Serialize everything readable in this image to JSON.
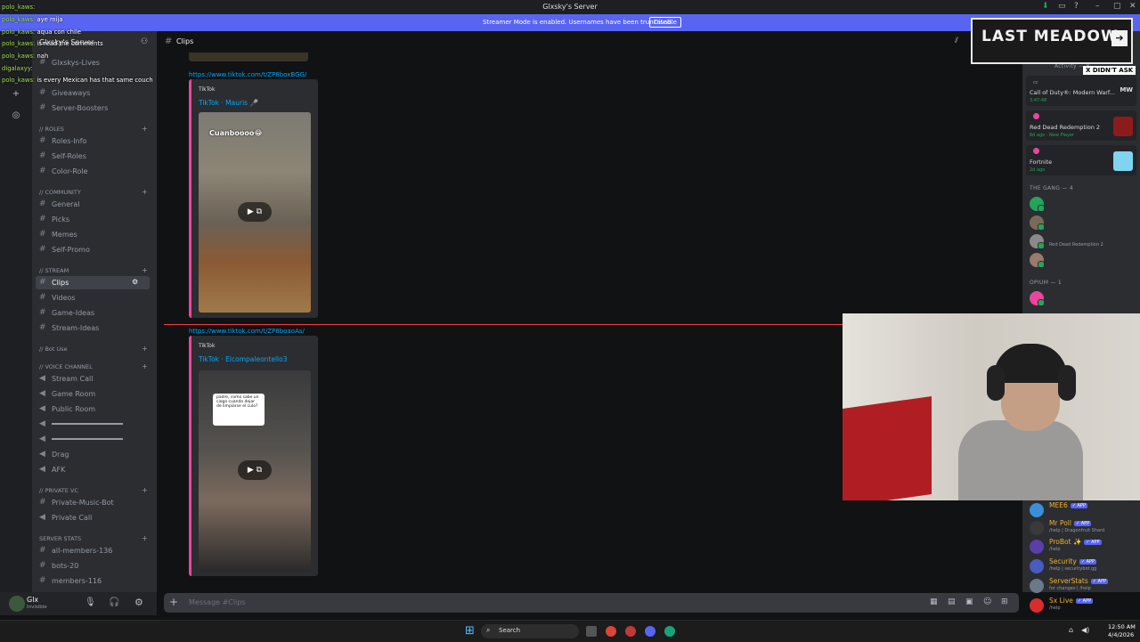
{
  "window": {
    "title": "Glxsky's Server"
  },
  "banner": {
    "message": "Streamer Mode is enabled. Usernames have been truncated.",
    "button": "Disable"
  },
  "server": {
    "name": "Glxsky's Server"
  },
  "channels": {
    "top": [
      "Glxskys-Lives",
      "Giveaways",
      "Server-Boosters"
    ],
    "roles_cat": "// ROLES",
    "roles": [
      "Roles-Info",
      "Self-Roles",
      "Color-Role"
    ],
    "community_cat": "// COMMUNITY",
    "community": [
      "General",
      "Picks",
      "Memes",
      "Self-Promo"
    ],
    "stream_cat": "// STREAM",
    "stream": [
      "Clips",
      "Videos",
      "Game-Ideas",
      "Stream-Ideas"
    ],
    "botuse_cat": "// Bot Use",
    "voice_cat": "// VOICE CHANNEL",
    "voice": [
      "Stream Call",
      "Game Room",
      "Public Room",
      "",
      "",
      "Drag",
      "AFK"
    ],
    "private_cat": "// PRIVATE VC",
    "private": [
      "Private-Music-Bot",
      "Private Call"
    ],
    "stats_cat": "SERVER STATS",
    "stats": [
      "all-members-136",
      "bots-20",
      "members-116"
    ]
  },
  "user": {
    "name": "Glx",
    "status": "Invisible"
  },
  "topbar": {
    "channel": "Clips"
  },
  "messages": [
    {
      "link": "https://www.tiktok.com/t/ZP8boxBGG/",
      "provider": "TikTok",
      "author": "TikTok · Mauris 🎤",
      "caption": "Cuanboooo😂"
    },
    {
      "link": "https://www.tiktok.com/t/ZP8boaoAs/",
      "provider": "TikTok",
      "author": "TikTok · Elcompaleontello3",
      "caption": "padre, como sabe un ciego cuando dejar de limpiarse el culo?"
    }
  ],
  "composer": {
    "placeholder": "Message #Clips"
  },
  "members": {
    "activity_head": "Activity — 8",
    "activities": [
      {
        "title": "Call of Duty®: Modern Warf...",
        "sub": "3:47:48",
        "label": "cc"
      },
      {
        "title": "Red Dead Redemption 2",
        "sub": "8d ago · New Player"
      },
      {
        "title": "Fortnite",
        "sub": "2d ago"
      }
    ],
    "gang_head": "THE GANG — 4",
    "gang_activity": "Red Dead Redemption 2",
    "opium_head": "OPIUM — 1",
    "bots": [
      {
        "name": "MEE6",
        "tag": "✓ APP",
        "sub": ""
      },
      {
        "name": "Mr Poll",
        "tag": "✓ APP",
        "sub": "/help | Dragonfruit Shard"
      },
      {
        "name": "ProBot ✨",
        "tag": "✓ APP",
        "sub": "/help"
      },
      {
        "name": "Security",
        "tag": "✓ APP",
        "sub": "/help | securitybot.gg"
      },
      {
        "name": "ServerStats",
        "tag": "✓ APP",
        "sub": "for changes | /help"
      },
      {
        "name": "Sx Live",
        "tag": "✓ APP",
        "sub": "/help"
      }
    ]
  },
  "overlay": {
    "logo": "LAST MEADOW",
    "badge": "X DIDN'T ASK",
    "chat": [
      {
        "user": "polo_kaws:",
        "msg": ""
      },
      {
        "user": "polo_kaws:",
        "msg": "aye mija"
      },
      {
        "user": "polo_kaws:",
        "msg": "aqua con chile"
      },
      {
        "user": "polo_kaws:",
        "msg": "is read the comments"
      },
      {
        "user": "polo_kaws:",
        "msg": "nah"
      },
      {
        "user": "digalaxyy:",
        "msg": ""
      },
      {
        "user": "polo_kaws:",
        "msg": "is every Mexican has that same couch"
      }
    ]
  },
  "taskbar": {
    "search": "Search",
    "time": "12:50 AM",
    "date": "4/4/2026"
  },
  "colors": {
    "accent": "#5865f2",
    "link": "#00a8fc",
    "embed_border": "#eb459e",
    "online": "#23a55a",
    "new_line": "#f23f43"
  }
}
